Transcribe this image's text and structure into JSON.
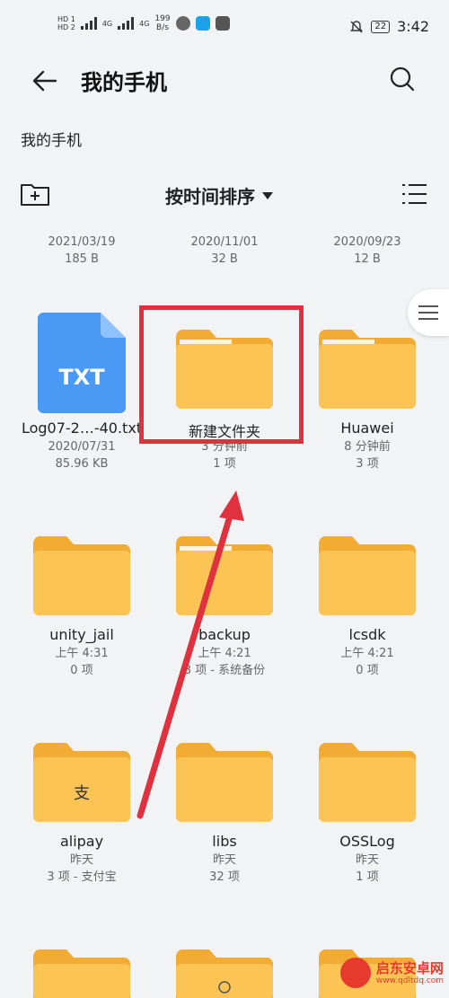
{
  "status_bar": {
    "hd1": "HD 1",
    "hd2": "HD 2",
    "net1": "4G",
    "net2": "4G",
    "speed_value": "199",
    "speed_unit": "B/s",
    "battery": "22",
    "time": "3:42"
  },
  "header": {
    "title": "我的手机"
  },
  "breadcrumb": "我的手机",
  "toolbar": {
    "sort_label": "按时间排序"
  },
  "top_row": [
    {
      "date": "2021/03/19",
      "size": "185 B"
    },
    {
      "date": "2020/11/01",
      "size": "32 B"
    },
    {
      "date": "2020/09/23",
      "size": "12 B"
    }
  ],
  "items": [
    {
      "name": "Log07-2…-40.txt",
      "line1": "2020/07/31",
      "line2": "85.96 KB",
      "type": "txt",
      "icon_text": "TXT"
    },
    {
      "name": "新建文件夹",
      "line1": "3 分钟前",
      "line2": "1 项",
      "type": "folder"
    },
    {
      "name": "Huawei",
      "line1": "8 分钟前",
      "line2": "3 项",
      "type": "folder"
    },
    {
      "name": "unity_jail",
      "line1": "上午 4:31",
      "line2": "0 项",
      "type": "folder"
    },
    {
      "name": "backup",
      "line1": "上午 4:21",
      "line2": "3 项 - 系统备份",
      "type": "folder"
    },
    {
      "name": "lcsdk",
      "line1": "上午 4:21",
      "line2": "0 项",
      "type": "folder"
    },
    {
      "name": "alipay",
      "line1": "昨天",
      "line2": "3 项 - 支付宝",
      "type": "folder",
      "badge": "支"
    },
    {
      "name": "libs",
      "line1": "昨天",
      "line2": "32 项",
      "type": "folder"
    },
    {
      "name": "OSSLog",
      "line1": "昨天",
      "line2": "1 项",
      "type": "folder"
    }
  ],
  "watermark": {
    "title": "启东安卓网",
    "url": "www.qdltdq.com"
  },
  "colors": {
    "folder": "#fbc454",
    "folder_tab": "#f3ac33",
    "txt": "#4a9af5",
    "highlight": "#e0313f"
  }
}
